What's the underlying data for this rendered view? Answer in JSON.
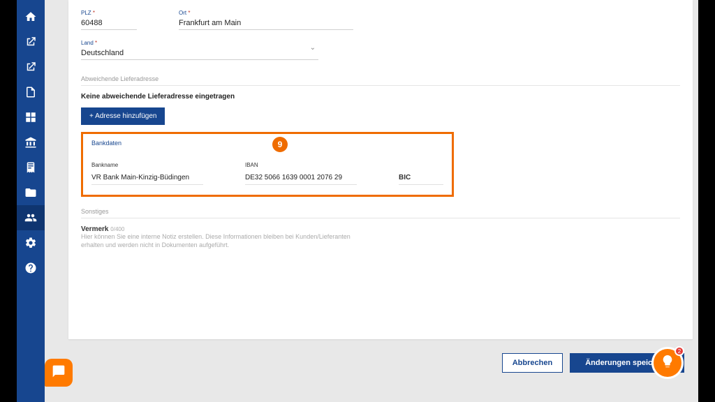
{
  "address": {
    "plz_label": "PLZ",
    "plz_value": "60488",
    "ort_label": "Ort",
    "ort_value": "Frankfurt am Main",
    "land_label": "Land",
    "land_value": "Deutschland",
    "required_mark": " *"
  },
  "delivery": {
    "section_title": "Abweichende Lieferadresse",
    "none_text": "Keine abweichende Lieferadresse eingetragen",
    "add_button": "+ Adresse hinzufügen"
  },
  "bank": {
    "section_title": "Bankdaten",
    "bankname_label": "Bankname",
    "bankname_value": "VR Bank Main-Kinzig-Büdingen",
    "iban_label": "IBAN",
    "iban_value": "DE32 5066 1639 0001 2076 29",
    "bic_label": "BIC"
  },
  "misc": {
    "section_title": "Sonstiges",
    "vermerk_label": "Vermerk",
    "vermerk_counter": "0/400",
    "vermerk_hint": "Hier können Sie eine interne Notiz erstellen. Diese Informationen bleiben bei Kunden/Lieferanten erhalten und werden nicht in Dokumenten aufgeführt."
  },
  "footer": {
    "cancel": "Abbrechen",
    "save": "Änderungen speichern"
  },
  "marker": {
    "step": "9"
  },
  "bulb": {
    "badge": "2"
  }
}
